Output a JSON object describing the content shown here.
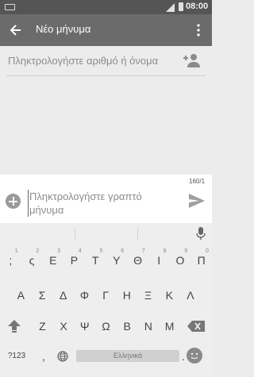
{
  "status_bar": {
    "time": "08:00"
  },
  "app_bar": {
    "title": "Νέο μήνυμα"
  },
  "recipient": {
    "placeholder": "Πληκτρολογήστε αριθμό ή όνομα"
  },
  "compose": {
    "counter": "160/1",
    "placeholder_line1": "Πληκτρολογήστε γραπτό",
    "placeholder_line2": "μήνυμα"
  },
  "keyboard": {
    "row1": [
      ";",
      "ς",
      "Ε",
      "Ρ",
      "Τ",
      "Υ",
      "Θ",
      "Ι",
      "Ο",
      "Π"
    ],
    "row1_hints": [
      "1",
      "2",
      "3",
      "4",
      "5",
      "6",
      "7",
      "8",
      "9",
      "0"
    ],
    "row2": [
      "Α",
      "Σ",
      "Δ",
      "Φ",
      "Γ",
      "Η",
      "Ξ",
      "Κ",
      "Λ"
    ],
    "row3": [
      "Ζ",
      "Χ",
      "Ψ",
      "Ω",
      "Β",
      "Ν",
      "Μ"
    ],
    "symbols_key": "?123",
    "comma_key": ",",
    "space_label": "Ελληνικά",
    "period_key": "."
  },
  "icons": [
    "keyboard-icon",
    "signal-icon",
    "battery-icon",
    "back-arrow-icon",
    "overflow-menu-icon",
    "add-contact-icon",
    "attach-icon",
    "send-icon",
    "mic-icon",
    "shift-icon",
    "backspace-icon",
    "globe-icon",
    "emoji-icon"
  ]
}
